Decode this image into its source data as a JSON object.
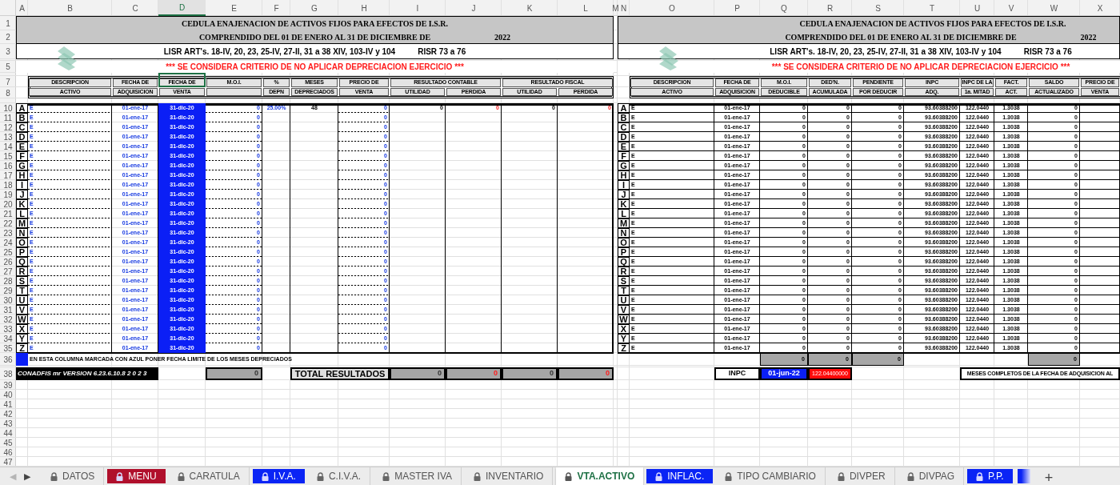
{
  "column_headers": [
    {
      "label": "A",
      "selected": false
    },
    {
      "label": "B",
      "selected": false
    },
    {
      "label": "C",
      "selected": false
    },
    {
      "label": "D",
      "selected": true
    },
    {
      "label": "E",
      "selected": false
    },
    {
      "label": "F",
      "selected": false
    },
    {
      "label": "G",
      "selected": false
    },
    {
      "label": "H",
      "selected": false
    },
    {
      "label": "I",
      "selected": false
    },
    {
      "label": "J",
      "selected": false
    },
    {
      "label": "K",
      "selected": false
    },
    {
      "label": "L",
      "selected": false
    },
    {
      "label": "M",
      "selected": false
    },
    {
      "label": "N",
      "selected": false
    },
    {
      "label": "O",
      "selected": false
    },
    {
      "label": "P",
      "selected": false
    },
    {
      "label": "Q",
      "selected": false
    },
    {
      "label": "R",
      "selected": false
    },
    {
      "label": "S",
      "selected": false
    },
    {
      "label": "T",
      "selected": false
    },
    {
      "label": "U",
      "selected": false
    },
    {
      "label": "V",
      "selected": false
    },
    {
      "label": "W",
      "selected": false
    },
    {
      "label": "X",
      "selected": false
    }
  ],
  "row_numbers": [
    "1",
    "2",
    "3",
    "5",
    "7",
    "8",
    "10",
    "11",
    "12",
    "13",
    "14",
    "15",
    "16",
    "17",
    "18",
    "19",
    "20",
    "21",
    "22",
    "23",
    "24",
    "25",
    "26",
    "27",
    "28",
    "29",
    "30",
    "31",
    "32",
    "33",
    "34",
    "35",
    "36",
    "38",
    "39",
    "40",
    "41",
    "42",
    "43",
    "44",
    "45",
    "46",
    "47"
  ],
  "left_form": {
    "title": "CEDULA ENAJENACION DE ACTIVOS FIJOS PARA EFECTOS DE I.S.R.",
    "subtitle": "COMPRENDIDO DEL 01 DE ENERO AL 31 DE DICIEMBRE DE",
    "year": "2022",
    "legal": "LISR ART's.  18-IV, 20, 23, 25-IV, 27-II, 31 a 38 XIV, 103-IV y 104",
    "risr": "RISR 73 a 76",
    "notice": "*** SE CONSIDERA CRITERIO DE NO APLICAR DEPRECIACION EJERCICIO ***",
    "headers": [
      {
        "label": "DESCRIPCION",
        "sub_labels": [
          "ACTIVO"
        ]
      },
      {
        "label": "FECHA DE",
        "sub_labels": [
          "ADQUISICION"
        ]
      },
      {
        "label": "FECHA DE",
        "sub_labels": [
          "VENTA"
        ]
      },
      {
        "label": "M.O.I."
      },
      {
        "label": "%",
        "sub_labels": [
          "DEPN"
        ]
      },
      {
        "label": "MESES",
        "sub_labels": [
          "DEPRECIADOS"
        ]
      },
      {
        "label": "PRECIO DE",
        "sub_labels": [
          "VENTA"
        ]
      },
      {
        "label": "RESULTADO CONTABLE",
        "sub_labels": [
          "UTILIDAD",
          "PERDIDA"
        ]
      },
      {
        "label": "RESULTADO FISCAL",
        "sub_labels": [
          "UTILIDAD",
          "PERDIDA"
        ]
      }
    ],
    "rows": [
      {
        "letter": "A",
        "description": "E",
        "acquired": "01-ene-17",
        "sold": "31-dic-20",
        "moi": "0",
        "depreciation_rate": "25.00%",
        "months": "48",
        "sale_price": "0",
        "book_gain": "0",
        "book_loss": "0",
        "tax_gain": "0",
        "tax_loss": "0"
      },
      {
        "letter": "B",
        "description": "E",
        "acquired": "01-ene-17",
        "sold": "31-dic-20",
        "moi": "0",
        "sale_price": "0"
      },
      {
        "letter": "C",
        "description": "E",
        "acquired": "01-ene-17",
        "sold": "31-dic-20",
        "moi": "0",
        "sale_price": "0"
      },
      {
        "letter": "D",
        "description": "E",
        "acquired": "01-ene-17",
        "sold": "31-dic-20",
        "moi": "0",
        "sale_price": "0"
      },
      {
        "letter": "E",
        "description": "E",
        "acquired": "01-ene-17",
        "sold": "31-dic-20",
        "moi": "0",
        "sale_price": "0"
      },
      {
        "letter": "F",
        "description": "E",
        "acquired": "01-ene-17",
        "sold": "31-dic-20",
        "moi": "0",
        "sale_price": "0"
      },
      {
        "letter": "G",
        "description": "E",
        "acquired": "01-ene-17",
        "sold": "31-dic-20",
        "moi": "0",
        "sale_price": "0"
      },
      {
        "letter": "H",
        "description": "E",
        "acquired": "01-ene-17",
        "sold": "31-dic-20",
        "moi": "0",
        "sale_price": "0"
      },
      {
        "letter": "I",
        "description": "E",
        "acquired": "01-ene-17",
        "sold": "31-dic-20",
        "moi": "0",
        "sale_price": "0"
      },
      {
        "letter": "J",
        "description": "E",
        "acquired": "01-ene-17",
        "sold": "31-dic-20",
        "moi": "0",
        "sale_price": "0"
      },
      {
        "letter": "K",
        "description": "E",
        "acquired": "01-ene-17",
        "sold": "31-dic-20",
        "moi": "0",
        "sale_price": "0"
      },
      {
        "letter": "L",
        "description": "E",
        "acquired": "01-ene-17",
        "sold": "31-dic-20",
        "moi": "0",
        "sale_price": "0"
      },
      {
        "letter": "M",
        "description": "E",
        "acquired": "01-ene-17",
        "sold": "31-dic-20",
        "moi": "0",
        "sale_price": "0"
      },
      {
        "letter": "N",
        "description": "E",
        "acquired": "01-ene-17",
        "sold": "31-dic-20",
        "moi": "0",
        "sale_price": "0"
      },
      {
        "letter": "O",
        "description": "E",
        "acquired": "01-ene-17",
        "sold": "31-dic-20",
        "moi": "0",
        "sale_price": "0"
      },
      {
        "letter": "P",
        "description": "E",
        "acquired": "01-ene-17",
        "sold": "31-dic-20",
        "moi": "0",
        "sale_price": "0"
      },
      {
        "letter": "Q",
        "description": "E",
        "acquired": "01-ene-17",
        "sold": "31-dic-20",
        "moi": "0",
        "sale_price": "0"
      },
      {
        "letter": "R",
        "description": "E",
        "acquired": "01-ene-17",
        "sold": "31-dic-20",
        "moi": "0",
        "sale_price": "0"
      },
      {
        "letter": "S",
        "description": "E",
        "acquired": "01-ene-17",
        "sold": "31-dic-20",
        "moi": "0",
        "sale_price": "0"
      },
      {
        "letter": "T",
        "description": "E",
        "acquired": "01-ene-17",
        "sold": "31-dic-20",
        "moi": "0",
        "sale_price": "0"
      },
      {
        "letter": "U",
        "description": "E",
        "acquired": "01-ene-17",
        "sold": "31-dic-20",
        "moi": "0",
        "sale_price": "0"
      },
      {
        "letter": "V",
        "description": "E",
        "acquired": "01-ene-17",
        "sold": "31-dic-20",
        "moi": "0",
        "sale_price": "0"
      },
      {
        "letter": "W",
        "description": "E",
        "acquired": "01-ene-17",
        "sold": "31-dic-20",
        "moi": "0",
        "sale_price": "0"
      },
      {
        "letter": "X",
        "description": "E",
        "acquired": "01-ene-17",
        "sold": "31-dic-20",
        "moi": "0",
        "sale_price": "0"
      },
      {
        "letter": "Y",
        "description": "E",
        "acquired": "01-ene-17",
        "sold": "31-dic-20",
        "moi": "0",
        "sale_price": "0"
      },
      {
        "letter": "Z",
        "description": "E",
        "acquired": "01-ene-17",
        "sold": "31-dic-20",
        "moi": "0",
        "sale_price": "0"
      }
    ],
    "legend_note": "EN ESTA COLUMNA MARCADA CON AZUL PONER FECHA LIMITE DE LOS MESES DEPRECIADOS",
    "version": "CONADFIS mr VERSION 6.23.6.10.8  2 0 2 3",
    "moi_total": "0",
    "totals_label": "TOTAL RESULTADOS",
    "totals": [
      "0",
      "0",
      "0",
      "0"
    ]
  },
  "right_form": {
    "title": "CEDULA ENAJENACION DE ACTIVOS FIJOS PARA EFECTOS DE I.S.R.",
    "subtitle": "COMPRENDIDO DEL 01 DE ENERO AL 31 DE DICIEMBRE DE",
    "year": "2022",
    "legal": "LISR ART's.  18-IV, 20, 23, 25-IV, 27-II, 31 a 38 XIV, 103-IV y 104",
    "risr": "RISR 73 a 76",
    "notice": "*** SE CONSIDERA CRITERIO DE NO APLICAR DEPRECIACION EJERCICIO ***",
    "headers": [
      {
        "label": "DESCRIPCION",
        "sub_labels": [
          "ACTIVO"
        ]
      },
      {
        "label": "FECHA DE",
        "sub_labels": [
          "ADQUISICION"
        ]
      },
      {
        "label": "M.O.I.",
        "sub_labels": [
          "DEDUCIBLE"
        ]
      },
      {
        "label": "DED'N.",
        "sub_labels": [
          "ACUMULADA"
        ]
      },
      {
        "label": "PENDIENTE",
        "sub_labels": [
          "POR DEDUCIR"
        ]
      },
      {
        "label": "INPC",
        "sub_labels": [
          "ADQ."
        ]
      },
      {
        "label": "INPC DE LA",
        "sub_labels": [
          "1a. MITAD"
        ]
      },
      {
        "label": "FACT.",
        "sub_labels": [
          "ACT."
        ]
      },
      {
        "label": "SALDO",
        "sub_labels": [
          "ACTUALIZADO"
        ]
      },
      {
        "label": "PRECIO DE",
        "sub_labels": [
          "VENTA"
        ]
      }
    ],
    "rows": [
      {
        "letter": "A",
        "description": "E",
        "acquired": "01-ene-17",
        "moi_deductible": "0",
        "accumulated": "0",
        "pending": "0",
        "inpc_acquisition": "93.60388200",
        "inpc_half": "122.0440",
        "factor": "1.3038",
        "updated_balance": "0"
      },
      {
        "letter": "B",
        "description": "E",
        "acquired": "01-ene-17",
        "moi_deductible": "0",
        "accumulated": "0",
        "pending": "0",
        "inpc_acquisition": "93.60388200",
        "inpc_half": "122.0440",
        "factor": "1.3038",
        "updated_balance": "0"
      },
      {
        "letter": "C",
        "description": "E",
        "acquired": "01-ene-17",
        "moi_deductible": "0",
        "accumulated": "0",
        "pending": "0",
        "inpc_acquisition": "93.60388200",
        "inpc_half": "122.0440",
        "factor": "1.3038",
        "updated_balance": "0"
      },
      {
        "letter": "D",
        "description": "E",
        "acquired": "01-ene-17",
        "moi_deductible": "0",
        "accumulated": "0",
        "pending": "0",
        "inpc_acquisition": "93.60388200",
        "inpc_half": "122.0440",
        "factor": "1.3038",
        "updated_balance": "0"
      },
      {
        "letter": "E",
        "description": "E",
        "acquired": "01-ene-17",
        "moi_deductible": "0",
        "accumulated": "0",
        "pending": "0",
        "inpc_acquisition": "93.60388200",
        "inpc_half": "122.0440",
        "factor": "1.3038",
        "updated_balance": "0"
      },
      {
        "letter": "F",
        "description": "E",
        "acquired": "01-ene-17",
        "moi_deductible": "0",
        "accumulated": "0",
        "pending": "0",
        "inpc_acquisition": "93.60388200",
        "inpc_half": "122.0440",
        "factor": "1.3038",
        "updated_balance": "0"
      },
      {
        "letter": "G",
        "description": "E",
        "acquired": "01-ene-17",
        "moi_deductible": "0",
        "accumulated": "0",
        "pending": "0",
        "inpc_acquisition": "93.60388200",
        "inpc_half": "122.0440",
        "factor": "1.3038",
        "updated_balance": "0"
      },
      {
        "letter": "H",
        "description": "E",
        "acquired": "01-ene-17",
        "moi_deductible": "0",
        "accumulated": "0",
        "pending": "0",
        "inpc_acquisition": "93.60388200",
        "inpc_half": "122.0440",
        "factor": "1.3038",
        "updated_balance": "0"
      },
      {
        "letter": "I",
        "description": "E",
        "acquired": "01-ene-17",
        "moi_deductible": "0",
        "accumulated": "0",
        "pending": "0",
        "inpc_acquisition": "93.60388200",
        "inpc_half": "122.0440",
        "factor": "1.3038",
        "updated_balance": "0"
      },
      {
        "letter": "J",
        "description": "E",
        "acquired": "01-ene-17",
        "moi_deductible": "0",
        "accumulated": "0",
        "pending": "0",
        "inpc_acquisition": "93.60388200",
        "inpc_half": "122.0440",
        "factor": "1.3038",
        "updated_balance": "0"
      },
      {
        "letter": "K",
        "description": "E",
        "acquired": "01-ene-17",
        "moi_deductible": "0",
        "accumulated": "0",
        "pending": "0",
        "inpc_acquisition": "93.60388200",
        "inpc_half": "122.0440",
        "factor": "1.3038",
        "updated_balance": "0"
      },
      {
        "letter": "L",
        "description": "E",
        "acquired": "01-ene-17",
        "moi_deductible": "0",
        "accumulated": "0",
        "pending": "0",
        "inpc_acquisition": "93.60388200",
        "inpc_half": "122.0440",
        "factor": "1.3038",
        "updated_balance": "0"
      },
      {
        "letter": "M",
        "description": "E",
        "acquired": "01-ene-17",
        "moi_deductible": "0",
        "accumulated": "0",
        "pending": "0",
        "inpc_acquisition": "93.60388200",
        "inpc_half": "122.0440",
        "factor": "1.3038",
        "updated_balance": "0"
      },
      {
        "letter": "N",
        "description": "E",
        "acquired": "01-ene-17",
        "moi_deductible": "0",
        "accumulated": "0",
        "pending": "0",
        "inpc_acquisition": "93.60388200",
        "inpc_half": "122.0440",
        "factor": "1.3038",
        "updated_balance": "0"
      },
      {
        "letter": "O",
        "description": "E",
        "acquired": "01-ene-17",
        "moi_deductible": "0",
        "accumulated": "0",
        "pending": "0",
        "inpc_acquisition": "93.60388200",
        "inpc_half": "122.0440",
        "factor": "1.3038",
        "updated_balance": "0"
      },
      {
        "letter": "P",
        "description": "E",
        "acquired": "01-ene-17",
        "moi_deductible": "0",
        "accumulated": "0",
        "pending": "0",
        "inpc_acquisition": "93.60388200",
        "inpc_half": "122.0440",
        "factor": "1.3038",
        "updated_balance": "0"
      },
      {
        "letter": "Q",
        "description": "E",
        "acquired": "01-ene-17",
        "moi_deductible": "0",
        "accumulated": "0",
        "pending": "0",
        "inpc_acquisition": "93.60388200",
        "inpc_half": "122.0440",
        "factor": "1.3038",
        "updated_balance": "0"
      },
      {
        "letter": "R",
        "description": "E",
        "acquired": "01-ene-17",
        "moi_deductible": "0",
        "accumulated": "0",
        "pending": "0",
        "inpc_acquisition": "93.60388200",
        "inpc_half": "122.0440",
        "factor": "1.3038",
        "updated_balance": "0"
      },
      {
        "letter": "S",
        "description": "E",
        "acquired": "01-ene-17",
        "moi_deductible": "0",
        "accumulated": "0",
        "pending": "0",
        "inpc_acquisition": "93.60388200",
        "inpc_half": "122.0440",
        "factor": "1.3038",
        "updated_balance": "0"
      },
      {
        "letter": "T",
        "description": "E",
        "acquired": "01-ene-17",
        "moi_deductible": "0",
        "accumulated": "0",
        "pending": "0",
        "inpc_acquisition": "93.60388200",
        "inpc_half": "122.0440",
        "factor": "1.3038",
        "updated_balance": "0"
      },
      {
        "letter": "U",
        "description": "E",
        "acquired": "01-ene-17",
        "moi_deductible": "0",
        "accumulated": "0",
        "pending": "0",
        "inpc_acquisition": "93.60388200",
        "inpc_half": "122.0440",
        "factor": "1.3038",
        "updated_balance": "0"
      },
      {
        "letter": "V",
        "description": "E",
        "acquired": "01-ene-17",
        "moi_deductible": "0",
        "accumulated": "0",
        "pending": "0",
        "inpc_acquisition": "93.60388200",
        "inpc_half": "122.0440",
        "factor": "1.3038",
        "updated_balance": "0"
      },
      {
        "letter": "W",
        "description": "E",
        "acquired": "01-ene-17",
        "moi_deductible": "0",
        "accumulated": "0",
        "pending": "0",
        "inpc_acquisition": "93.60388200",
        "inpc_half": "122.0440",
        "factor": "1.3038",
        "updated_balance": "0"
      },
      {
        "letter": "X",
        "description": "E",
        "acquired": "01-ene-17",
        "moi_deductible": "0",
        "accumulated": "0",
        "pending": "0",
        "inpc_acquisition": "93.60388200",
        "inpc_half": "122.0440",
        "factor": "1.3038",
        "updated_balance": "0"
      },
      {
        "letter": "Y",
        "description": "E",
        "acquired": "01-ene-17",
        "moi_deductible": "0",
        "accumulated": "0",
        "pending": "0",
        "inpc_acquisition": "93.60388200",
        "inpc_half": "122.0440",
        "factor": "1.3038",
        "updated_balance": "0"
      },
      {
        "letter": "Z",
        "description": "E",
        "acquired": "01-ene-17",
        "moi_deductible": "0",
        "accumulated": "0",
        "pending": "0",
        "inpc_acquisition": "93.60388200",
        "inpc_half": "122.0440",
        "factor": "1.3038",
        "updated_balance": "0"
      }
    ],
    "column_totals": [
      "0",
      "0",
      "0"
    ],
    "balance_total": "0",
    "inpc_label": "INPC",
    "inpc_date": "01-jun-22",
    "inpc_value": "122.04400000",
    "months_note": "MESES COMPLETOS DE LA FECHA DE ADQUISICION AL"
  },
  "sheet_nav": [
    {
      "label": "◀",
      "disabled": true
    },
    {
      "label": "▶",
      "disabled": false
    }
  ],
  "tabs": [
    {
      "label": "DATOS",
      "locked": true,
      "selected": false
    },
    {
      "label": "MENU",
      "locked": true,
      "selected": false,
      "color": "#b0102c"
    },
    {
      "label": "CARATULA",
      "locked": true,
      "selected": false
    },
    {
      "label": "I.V.A.",
      "locked": true,
      "selected": false,
      "color": "#0a24f5"
    },
    {
      "label": "C.I.V.A.",
      "locked": true,
      "selected": false
    },
    {
      "label": "MASTER IVA",
      "locked": true,
      "selected": false
    },
    {
      "label": "INVENTARIO",
      "locked": true,
      "selected": false
    },
    {
      "label": "VTA.ACTIVO",
      "locked": true,
      "selected": true
    },
    {
      "label": "INFLAC.",
      "locked": true,
      "selected": false,
      "color": "#0a24f5"
    },
    {
      "label": "TIPO CAMBIARIO",
      "locked": true,
      "selected": false
    },
    {
      "label": "DIVPER",
      "locked": true,
      "selected": false
    },
    {
      "label": "DIVPAG",
      "locked": true,
      "selected": false
    },
    {
      "label": "P.P.",
      "locked": true,
      "selected": false,
      "color": "#0a24f5"
    },
    {
      "selected": false,
      "color": "#0a24f5"
    }
  ],
  "add_sheet": "+"
}
